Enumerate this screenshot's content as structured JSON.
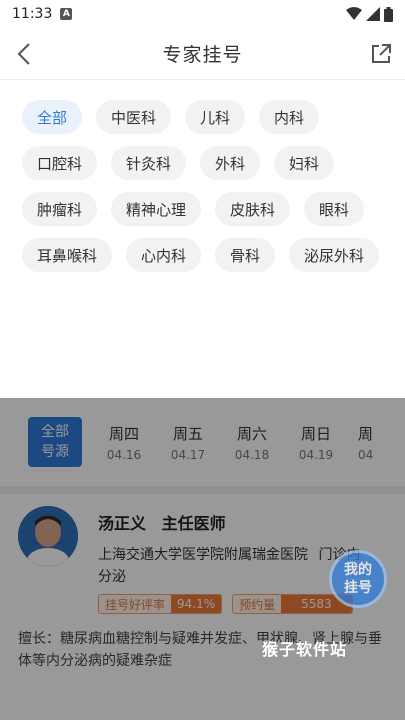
{
  "status_bar": {
    "time": "11:33",
    "notification_icon": "A"
  },
  "header": {
    "title": "专家挂号"
  },
  "departments": [
    {
      "label": "全部",
      "active": true
    },
    {
      "label": "中医科"
    },
    {
      "label": "儿科"
    },
    {
      "label": "内科"
    },
    {
      "label": "口腔科"
    },
    {
      "label": "针灸科"
    },
    {
      "label": "外科"
    },
    {
      "label": "妇科"
    },
    {
      "label": "肿瘤科"
    },
    {
      "label": "精神心理"
    },
    {
      "label": "皮肤科"
    },
    {
      "label": "眼科"
    },
    {
      "label": "耳鼻喉科"
    },
    {
      "label": "心内科"
    },
    {
      "label": "骨科"
    },
    {
      "label": "泌尿外科"
    }
  ],
  "schedule": {
    "all_line1": "全部",
    "all_line2": "号源",
    "days": [
      {
        "name": "周四",
        "date": "04.16"
      },
      {
        "name": "周五",
        "date": "04.17"
      },
      {
        "name": "周六",
        "date": "04.18"
      },
      {
        "name": "周日",
        "date": "04.19"
      },
      {
        "name": "周",
        "date": "04"
      }
    ]
  },
  "doctor": {
    "name": "汤正义",
    "title": "主任医师",
    "hospital": "上海交通大学医学院附属瑞金医院",
    "dept_suffix": "门诊内",
    "dept_line2": "分泌",
    "rating_label": "挂号好评率",
    "rating_value": "94.1%",
    "booked_label": "预约量",
    "booked_value": "5583",
    "specialty": "擅长：糖尿病血糖控制与疑难并发症、甲状腺、肾上腺与垂体等内分泌病的疑难杂症"
  },
  "floating": {
    "line1": "我的",
    "line2": "挂号"
  },
  "watermark": "猴子软件站",
  "colors": {
    "accent": "#2f7bd9",
    "orange": "#ef7b3a"
  }
}
